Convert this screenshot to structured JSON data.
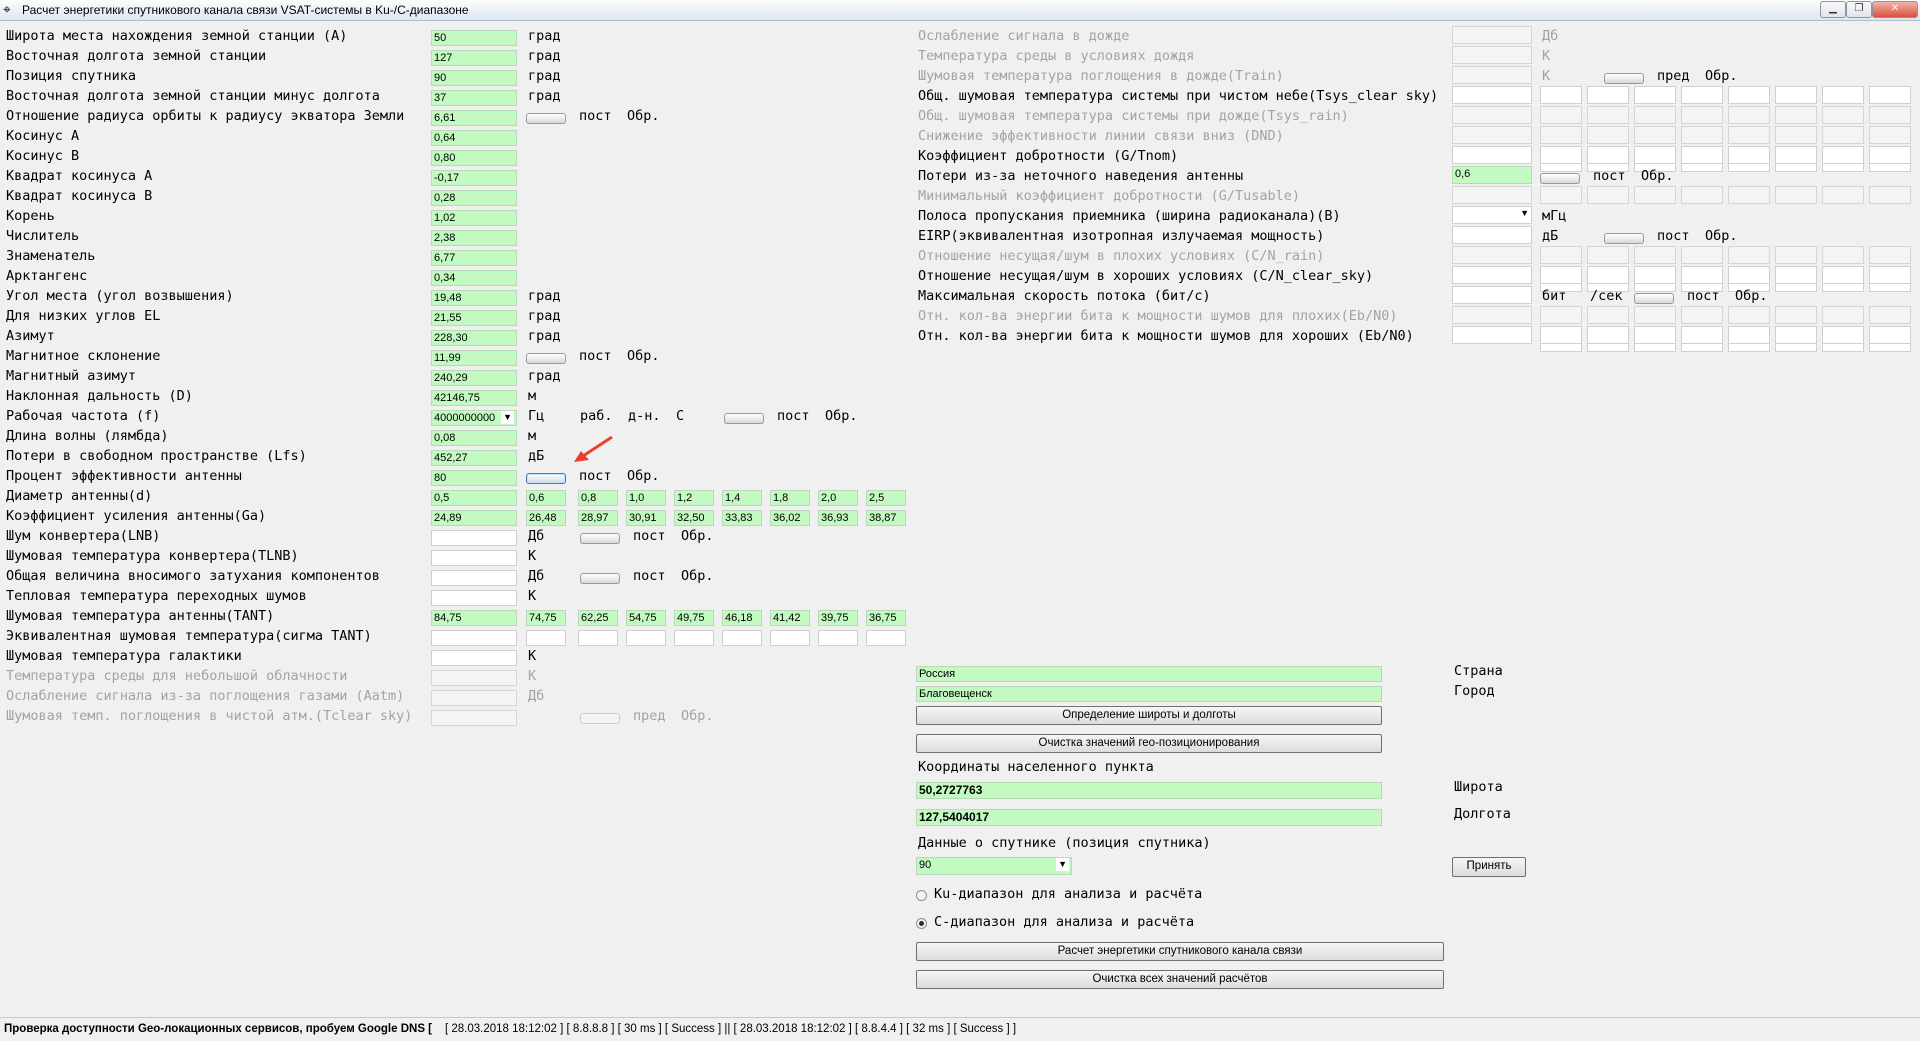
{
  "window": {
    "title": "Расчет энергетики спутникового канала связи VSAT-системы в Ku-/C-диапазоне",
    "icon": "satellite-icon"
  },
  "left_rows": [
    {
      "label": "Широта места нахождения земной станции (А)",
      "value": "50",
      "unit": "град"
    },
    {
      "label": "Восточная долгота земной станции",
      "value": "127",
      "unit": "град"
    },
    {
      "label": "Позиция спутника",
      "value": "90",
      "unit": "град"
    },
    {
      "label": "Восточная долгота земной станции минус долгота",
      "value": "37",
      "unit": "град"
    },
    {
      "label": "Отношение радиуса  орбиты к радиусу экватора Земли",
      "value": "6,61",
      "unit": ""
    },
    {
      "label": "Косинус А",
      "value": "0,64",
      "unit": ""
    },
    {
      "label": "Косинус В",
      "value": "0,80",
      "unit": ""
    },
    {
      "label": "Квадрат косинуса А",
      "value": "-0,17",
      "unit": ""
    },
    {
      "label": "Квадрат косинуса В",
      "value": "0,28",
      "unit": ""
    },
    {
      "label": "Корень",
      "value": "1,02",
      "unit": ""
    },
    {
      "label": "Числитель",
      "value": "2,38",
      "unit": ""
    },
    {
      "label": "Знаменатель",
      "value": "6,77",
      "unit": ""
    },
    {
      "label": "Арктангенс",
      "value": "0,34",
      "unit": ""
    },
    {
      "label": "Угол места (угол возвышения)",
      "value": "19,48",
      "unit": "град"
    },
    {
      "label": "Для низких углов EL",
      "value": "21,55",
      "unit": "град"
    },
    {
      "label": "Азимут",
      "value": "228,30",
      "unit": "град"
    },
    {
      "label": "Магнитное склонение",
      "value": "11,99",
      "unit": ""
    },
    {
      "label": "Магнитный азимут",
      "value": "240,29",
      "unit": "град"
    },
    {
      "label": "Наклонная дальность (D)",
      "value": "42146,75",
      "unit": "м"
    },
    {
      "label": "Рабочая частота (f)",
      "value": "4000000000",
      "unit": "Гц"
    },
    {
      "label": "Длина волны (лямбда)",
      "value": "0,08",
      "unit": "м"
    },
    {
      "label": "Потери в свободном пространстве (Lfs)",
      "value": "452,27",
      "unit": "дБ"
    },
    {
      "label": "Процент эффективности антенны",
      "value": "80",
      "unit": ""
    },
    {
      "label": "Диаметр антенны(d)",
      "value": "0,5",
      "unit": ""
    },
    {
      "label": "Коэффициент усиления антенны(Ga)",
      "value": "24,89",
      "unit": ""
    },
    {
      "label": "Шум конвертера(LNB)",
      "value": "",
      "unit": "Дб"
    },
    {
      "label": "Шумовая температура конвертера(TLNB)",
      "value": "",
      "unit": "К"
    },
    {
      "label": "Общая величина вносимого затухания компонентов",
      "value": "",
      "unit": "Дб"
    },
    {
      "label": "Тепловая температура переходных шумов",
      "value": "",
      "unit": "К"
    },
    {
      "label": "Шумовая температура антенны(TANT)",
      "value": "84,75",
      "unit": ""
    },
    {
      "label": "Эквивалентная шумовая температура(сигма TANT)",
      "value": "",
      "unit": ""
    },
    {
      "label": "Шумовая температура галактики",
      "value": "",
      "unit": "К"
    },
    {
      "label": "Температура среды для небольшой облачности",
      "value": "",
      "unit": "К"
    },
    {
      "label": "Ослабление сигнала из-за поглощения газами (Aatm)",
      "value": "",
      "unit": "Дб"
    },
    {
      "label": "Шумовая темп. поглощения в чистой атм.(Tclear sky)",
      "value": "",
      "unit": ""
    }
  ],
  "frequency_extra": {
    "rab": "раб.",
    "dn": "д-н.",
    "band": "С"
  },
  "diameter_series": [
    "0,6",
    "0,8",
    "1,0",
    "1,2",
    "1,4",
    "1,8",
    "2,0",
    "2,5"
  ],
  "gain_series": [
    "26,48",
    "28,97",
    "30,91",
    "32,50",
    "33,83",
    "36,02",
    "36,93",
    "38,87"
  ],
  "tant_series": [
    "74,75",
    "62,25",
    "54,75",
    "49,75",
    "46,18",
    "41,42",
    "39,75",
    "36,75"
  ],
  "sigma_series": [
    "",
    "",
    "",
    "",
    "",
    "",
    "",
    ""
  ],
  "toggle_labels": {
    "post": "пост",
    "reset": "Обр.",
    "pred": "пред"
  },
  "right_rows": [
    {
      "label": "Ослабление сигнала в дожде",
      "value": "",
      "unit": "Дб"
    },
    {
      "label": "Температура среды в условиях дождя",
      "value": "",
      "unit": "К"
    },
    {
      "label": "Шумовая температура поглощения в дожде(Train)",
      "value": "",
      "unit": "К"
    },
    {
      "label": "Общ. шумовая температура системы при чистом небе(Tsys_clear sky)",
      "value": "",
      "unit": ""
    },
    {
      "label": "Общ. шумовая температура системы при дожде(Tsys_rain)",
      "value": "",
      "unit": ""
    },
    {
      "label": "Снижение эффективности линии связи вниз (DND)",
      "value": "",
      "unit": ""
    },
    {
      "label": "Коэффициент добротности (G/Tnom)",
      "value": "",
      "unit": ""
    },
    {
      "label": "Потери из-за неточного наведения антенны",
      "value": "0,6",
      "unit": ""
    },
    {
      "label": "Минимальный коэффициент добротности (G/Tusable)",
      "value": "",
      "unit": ""
    },
    {
      "label": "Полоса пропускания приемника (ширина радиоканала)(B)",
      "value": "",
      "unit": "мГц"
    },
    {
      "label": "EIRP(эквивалентная изотропная излучаемая мощность)",
      "value": "",
      "unit": "дБ"
    },
    {
      "label": "Отношение несущая/шум в плохих условиях (C/N_rain)",
      "value": "",
      "unit": ""
    },
    {
      "label": "Отношение несущая/шум в хороших условиях (C/N_clear_sky)",
      "value": "",
      "unit": ""
    },
    {
      "label": "Максимальная скорость потока (бит/с)",
      "value": "",
      "unit": "бит"
    },
    {
      "label": "Отн. кол-ва энергии бита к мощности шумов для плохих(Eb/N0)",
      "value": "",
      "unit": ""
    },
    {
      "label": "Отн. кол-ва энергии бита к мощности шумов для хороших (Eb/N0)",
      "value": "",
      "unit": ""
    }
  ],
  "rate_unit_extra": "/сек",
  "geo": {
    "country_value": "Россия",
    "country_label": "Страна",
    "city_value": "Благовещенск",
    "city_label": "Город",
    "find_button": "Определение широты и долготы",
    "clear_geo_button": "Очистка значений гео-позиционирования",
    "coords_header": "Координаты населенного пункта",
    "lat_value": "50,2727763",
    "lat_label": "Широта",
    "lon_value": "127,5404017",
    "lon_label": "Долгота",
    "sat_header": "Данные о спутнике (позиция спутника)",
    "sat_value": "90",
    "accept_button": "Принять",
    "ku_radio": "Ku-диапазон для анализа и расчёта",
    "c_radio": "С-диапазон для анализа и расчёта",
    "band_selected": "C",
    "calc_button": "Расчет энергетики спутникового канала связи",
    "clear_all_button": "Очистка всех значений расчётов"
  },
  "status": {
    "main": "Проверка доступности Geo-локационных сервисов, пробуем Google DNS [",
    "log": "[ 28.03.2018 18:12:02 ] [ 8.8.8.8 ] [ 30 ms ] [ Success ]  ||  [ 28.03.2018 18:12:02 ] [ 8.8.4.4 ] [ 32 ms ] [ Success ]  ]"
  },
  "colors": {
    "field_green": "#c2fac2",
    "arrow_red": "#e8412c"
  }
}
